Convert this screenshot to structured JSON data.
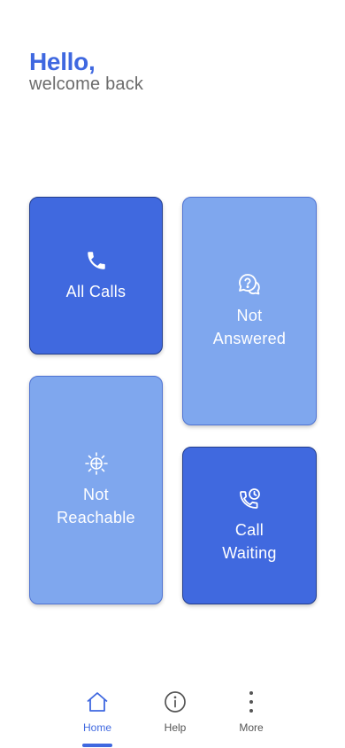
{
  "header": {
    "greeting": "Hello,",
    "subtitle": "welcome back"
  },
  "tiles": [
    {
      "label": "All Calls",
      "icon": "phone-icon",
      "style": "dark"
    },
    {
      "label": "Not\nAnswered",
      "icon": "question-chat-icon",
      "style": "light"
    },
    {
      "label": "Not\nReachable",
      "icon": "signal-antenna-icon",
      "style": "light"
    },
    {
      "label": "Call\nWaiting",
      "icon": "phone-clock-icon",
      "style": "dark"
    }
  ],
  "nav": {
    "items": [
      {
        "label": "Home",
        "icon": "home-icon",
        "active": true
      },
      {
        "label": "Help",
        "icon": "info-icon",
        "active": false
      },
      {
        "label": "More",
        "icon": "more-vertical-icon",
        "active": false
      }
    ]
  },
  "colors": {
    "primary": "#3f68e0",
    "tile_dark": "#4069df",
    "tile_light": "#7fa7ee",
    "subtitle_gray": "#6b6b6b"
  }
}
